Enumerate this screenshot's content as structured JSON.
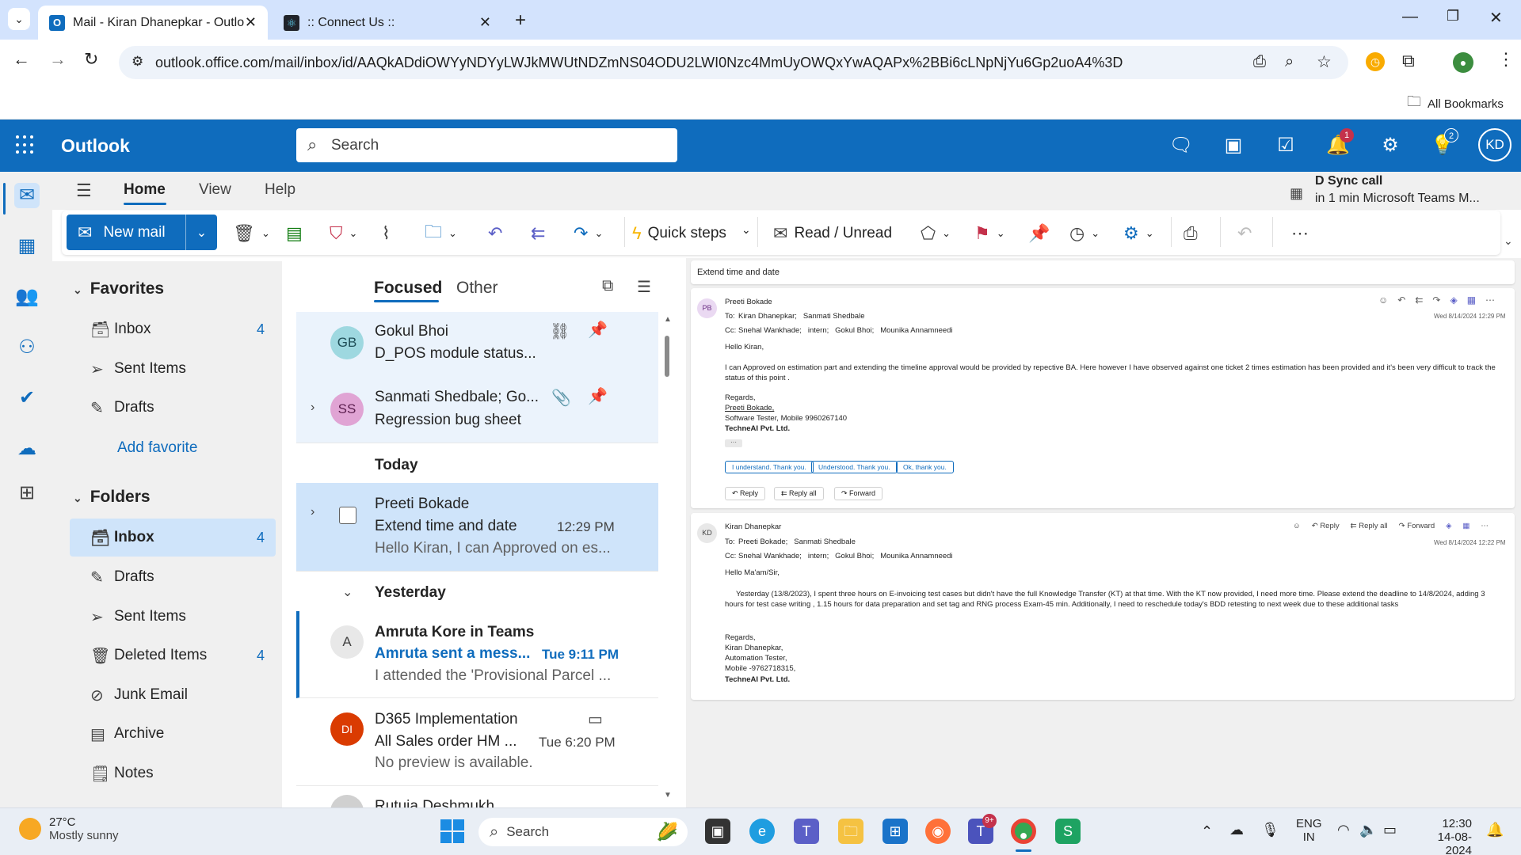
{
  "browser": {
    "tabs": [
      {
        "title": "Mail - Kiran Dhanepkar - Outlo"
      },
      {
        "title": ":: Connect Us ::"
      }
    ],
    "url": "outlook.office.com/mail/inbox/id/AAQkADdiOWYyNDYyLWJkMWUtNDZmNS04ODU2LWI0Nzc4MmUyOWQxYwAQAPx%2BBi6cLNpNjYu6Gp2uoA4%3D",
    "bookmarks_label": "All Bookmarks"
  },
  "header": {
    "app_name": "Outlook",
    "search_placeholder": "Search",
    "notif_count": "1",
    "help_count": "2",
    "avatar_initials": "KD"
  },
  "ribbon": {
    "tabs": [
      "Home",
      "View",
      "Help"
    ],
    "new_mail": "New mail",
    "quick_steps": "Quick steps",
    "read_unread": "Read / Unread"
  },
  "reminder": {
    "title": "D Sync call",
    "detail": "in 1 min Microsoft Teams M..."
  },
  "favorites": {
    "heading": "Favorites",
    "items": [
      {
        "label": "Inbox",
        "count": "4"
      },
      {
        "label": "Sent Items",
        "count": ""
      },
      {
        "label": "Drafts",
        "count": ""
      }
    ],
    "add": "Add favorite"
  },
  "folders": {
    "heading": "Folders",
    "items": [
      {
        "label": "Inbox",
        "count": "4"
      },
      {
        "label": "Drafts",
        "count": ""
      },
      {
        "label": "Sent Items",
        "count": ""
      },
      {
        "label": "Deleted Items",
        "count": "4"
      },
      {
        "label": "Junk Email",
        "count": ""
      },
      {
        "label": "Archive",
        "count": ""
      },
      {
        "label": "Notes",
        "count": ""
      }
    ]
  },
  "list": {
    "tabs": {
      "focused": "Focused",
      "other": "Other"
    },
    "pinned": [
      {
        "initials": "GB",
        "sender": "Gokul Bhoi",
        "subject": "D_POS module status..."
      },
      {
        "initials": "SS",
        "sender": "Sanmati Shedbale; Go...",
        "subject": "Regression bug sheet"
      }
    ],
    "today_label": "Today",
    "today": [
      {
        "sender": "Preeti Bokade",
        "subject": "Extend time and date",
        "time": "12:29 PM",
        "preview": "Hello Kiran, I can Approved on es..."
      }
    ],
    "yesterday_label": "Yesterday",
    "yesterday": [
      {
        "initials": "A",
        "sender": "Amruta Kore in Teams",
        "subject": "Amruta sent a mess...",
        "time": "Tue 9:11 PM",
        "preview": "I attended the 'Provisional Parcel ..."
      },
      {
        "initials": "DI",
        "sender": "D365 Implementation",
        "subject": "All Sales order HM ...",
        "time": "Tue 6:20 PM",
        "preview": "No preview is available."
      },
      {
        "sender": "Rutuja Deshmukh"
      }
    ]
  },
  "reading": {
    "subject": "Extend time and date",
    "msg1": {
      "initials": "PB",
      "from": "Preeti Bokade",
      "to_label": "To:",
      "to": "Kiran Dhanepkar;   Sanmati Shedbale",
      "cc_label": "Cc:",
      "cc": "Snehal Wankhade;   intern;   Gokul Bhoi;   Mounika Annamneedi",
      "date": "Wed 8/14/2024 12:29 PM",
      "greeting": "Hello Kiran,",
      "body": "I can Approved  on estimation part and extending the timeline approval would be provided by repective BA. Here however I have observed against one ticket  2 times estimation has been provided and it's been very difficult to track the status of this point .",
      "sig": [
        "Regards,",
        "Preeti Bokade,",
        "Software Tester, Mobile 9960267140",
        "TechneAI Pvt. Ltd."
      ],
      "suggestions": [
        "I understand. Thank you.",
        "Understood. Thank you.",
        "Ok, thank you."
      ],
      "actions": [
        "Reply",
        "Reply all",
        "Forward"
      ]
    },
    "msg2": {
      "initials": "KD",
      "from": "Kiran Dhanepkar",
      "to_label": "To:",
      "to": "Preeti Bokade;   Sanmati Shedbale",
      "cc_label": "Cc:",
      "cc": "Snehal Wankhade;   intern;   Gokul Bhoi;   Mounika Annamneedi",
      "date": "Wed 8/14/2024 12:22 PM",
      "actions": [
        "Reply",
        "Reply all",
        "Forward"
      ],
      "greeting": "Hello Ma'am/Sir,",
      "body": "Yesterday (13/8/2023), I spent three hours on E-invoicing test cases but didn't have the full Knowledge Transfer (KT) at that time. With the KT now provided, I need more time. Please extend the deadline to 14/8/2024, adding 3 hours for test case writing , 1.15 hours for data preparation and set tag and RNG process Exam-45 min. Additionally, I need to reschedule today's BDD retesting to next week due to these additional tasks",
      "sig": [
        "Regards,",
        "Kiran Dhanepkar,",
        "Automation Tester,",
        "Mobile -9762718315,",
        "TechneAI Pvt. Ltd."
      ]
    }
  },
  "taskbar": {
    "temp": "27°C",
    "weather": "Mostly sunny",
    "search": "Search",
    "lang1": "ENG",
    "lang2": "IN",
    "time": "12:30",
    "date": "14-08-2024",
    "teams_badge": "9+"
  }
}
